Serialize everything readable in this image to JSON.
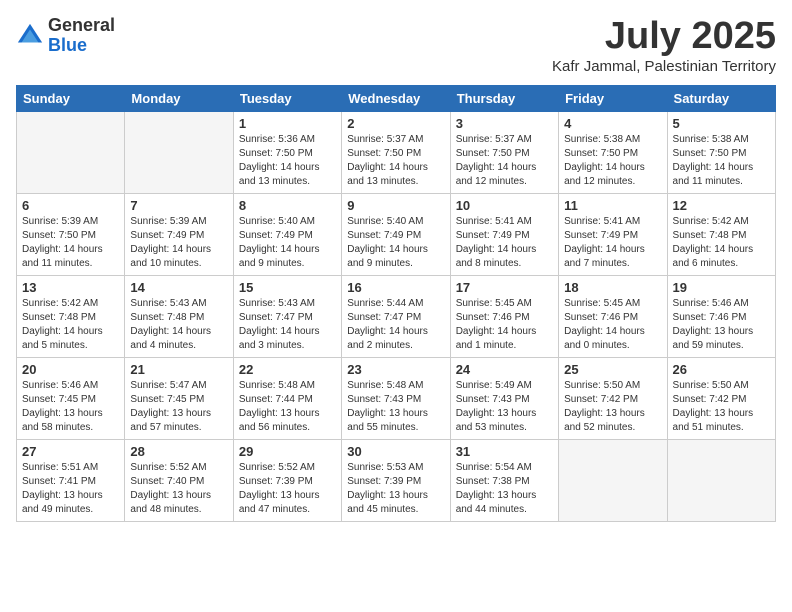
{
  "header": {
    "logo_general": "General",
    "logo_blue": "Blue",
    "month_year": "July 2025",
    "location": "Kafr Jammal, Palestinian Territory"
  },
  "days_of_week": [
    "Sunday",
    "Monday",
    "Tuesday",
    "Wednesday",
    "Thursday",
    "Friday",
    "Saturday"
  ],
  "weeks": [
    [
      {
        "day": "",
        "sunrise": "",
        "sunset": "",
        "daylight": "",
        "empty": true
      },
      {
        "day": "",
        "sunrise": "",
        "sunset": "",
        "daylight": "",
        "empty": true
      },
      {
        "day": "1",
        "sunrise": "Sunrise: 5:36 AM",
        "sunset": "Sunset: 7:50 PM",
        "daylight": "Daylight: 14 hours and 13 minutes."
      },
      {
        "day": "2",
        "sunrise": "Sunrise: 5:37 AM",
        "sunset": "Sunset: 7:50 PM",
        "daylight": "Daylight: 14 hours and 13 minutes."
      },
      {
        "day": "3",
        "sunrise": "Sunrise: 5:37 AM",
        "sunset": "Sunset: 7:50 PM",
        "daylight": "Daylight: 14 hours and 12 minutes."
      },
      {
        "day": "4",
        "sunrise": "Sunrise: 5:38 AM",
        "sunset": "Sunset: 7:50 PM",
        "daylight": "Daylight: 14 hours and 12 minutes."
      },
      {
        "day": "5",
        "sunrise": "Sunrise: 5:38 AM",
        "sunset": "Sunset: 7:50 PM",
        "daylight": "Daylight: 14 hours and 11 minutes."
      }
    ],
    [
      {
        "day": "6",
        "sunrise": "Sunrise: 5:39 AM",
        "sunset": "Sunset: 7:50 PM",
        "daylight": "Daylight: 14 hours and 11 minutes."
      },
      {
        "day": "7",
        "sunrise": "Sunrise: 5:39 AM",
        "sunset": "Sunset: 7:49 PM",
        "daylight": "Daylight: 14 hours and 10 minutes."
      },
      {
        "day": "8",
        "sunrise": "Sunrise: 5:40 AM",
        "sunset": "Sunset: 7:49 PM",
        "daylight": "Daylight: 14 hours and 9 minutes."
      },
      {
        "day": "9",
        "sunrise": "Sunrise: 5:40 AM",
        "sunset": "Sunset: 7:49 PM",
        "daylight": "Daylight: 14 hours and 9 minutes."
      },
      {
        "day": "10",
        "sunrise": "Sunrise: 5:41 AM",
        "sunset": "Sunset: 7:49 PM",
        "daylight": "Daylight: 14 hours and 8 minutes."
      },
      {
        "day": "11",
        "sunrise": "Sunrise: 5:41 AM",
        "sunset": "Sunset: 7:49 PM",
        "daylight": "Daylight: 14 hours and 7 minutes."
      },
      {
        "day": "12",
        "sunrise": "Sunrise: 5:42 AM",
        "sunset": "Sunset: 7:48 PM",
        "daylight": "Daylight: 14 hours and 6 minutes."
      }
    ],
    [
      {
        "day": "13",
        "sunrise": "Sunrise: 5:42 AM",
        "sunset": "Sunset: 7:48 PM",
        "daylight": "Daylight: 14 hours and 5 minutes."
      },
      {
        "day": "14",
        "sunrise": "Sunrise: 5:43 AM",
        "sunset": "Sunset: 7:48 PM",
        "daylight": "Daylight: 14 hours and 4 minutes."
      },
      {
        "day": "15",
        "sunrise": "Sunrise: 5:43 AM",
        "sunset": "Sunset: 7:47 PM",
        "daylight": "Daylight: 14 hours and 3 minutes."
      },
      {
        "day": "16",
        "sunrise": "Sunrise: 5:44 AM",
        "sunset": "Sunset: 7:47 PM",
        "daylight": "Daylight: 14 hours and 2 minutes."
      },
      {
        "day": "17",
        "sunrise": "Sunrise: 5:45 AM",
        "sunset": "Sunset: 7:46 PM",
        "daylight": "Daylight: 14 hours and 1 minute."
      },
      {
        "day": "18",
        "sunrise": "Sunrise: 5:45 AM",
        "sunset": "Sunset: 7:46 PM",
        "daylight": "Daylight: 14 hours and 0 minutes."
      },
      {
        "day": "19",
        "sunrise": "Sunrise: 5:46 AM",
        "sunset": "Sunset: 7:46 PM",
        "daylight": "Daylight: 13 hours and 59 minutes."
      }
    ],
    [
      {
        "day": "20",
        "sunrise": "Sunrise: 5:46 AM",
        "sunset": "Sunset: 7:45 PM",
        "daylight": "Daylight: 13 hours and 58 minutes."
      },
      {
        "day": "21",
        "sunrise": "Sunrise: 5:47 AM",
        "sunset": "Sunset: 7:45 PM",
        "daylight": "Daylight: 13 hours and 57 minutes."
      },
      {
        "day": "22",
        "sunrise": "Sunrise: 5:48 AM",
        "sunset": "Sunset: 7:44 PM",
        "daylight": "Daylight: 13 hours and 56 minutes."
      },
      {
        "day": "23",
        "sunrise": "Sunrise: 5:48 AM",
        "sunset": "Sunset: 7:43 PM",
        "daylight": "Daylight: 13 hours and 55 minutes."
      },
      {
        "day": "24",
        "sunrise": "Sunrise: 5:49 AM",
        "sunset": "Sunset: 7:43 PM",
        "daylight": "Daylight: 13 hours and 53 minutes."
      },
      {
        "day": "25",
        "sunrise": "Sunrise: 5:50 AM",
        "sunset": "Sunset: 7:42 PM",
        "daylight": "Daylight: 13 hours and 52 minutes."
      },
      {
        "day": "26",
        "sunrise": "Sunrise: 5:50 AM",
        "sunset": "Sunset: 7:42 PM",
        "daylight": "Daylight: 13 hours and 51 minutes."
      }
    ],
    [
      {
        "day": "27",
        "sunrise": "Sunrise: 5:51 AM",
        "sunset": "Sunset: 7:41 PM",
        "daylight": "Daylight: 13 hours and 49 minutes."
      },
      {
        "day": "28",
        "sunrise": "Sunrise: 5:52 AM",
        "sunset": "Sunset: 7:40 PM",
        "daylight": "Daylight: 13 hours and 48 minutes."
      },
      {
        "day": "29",
        "sunrise": "Sunrise: 5:52 AM",
        "sunset": "Sunset: 7:39 PM",
        "daylight": "Daylight: 13 hours and 47 minutes."
      },
      {
        "day": "30",
        "sunrise": "Sunrise: 5:53 AM",
        "sunset": "Sunset: 7:39 PM",
        "daylight": "Daylight: 13 hours and 45 minutes."
      },
      {
        "day": "31",
        "sunrise": "Sunrise: 5:54 AM",
        "sunset": "Sunset: 7:38 PM",
        "daylight": "Daylight: 13 hours and 44 minutes."
      },
      {
        "day": "",
        "sunrise": "",
        "sunset": "",
        "daylight": "",
        "empty": true
      },
      {
        "day": "",
        "sunrise": "",
        "sunset": "",
        "daylight": "",
        "empty": true
      }
    ]
  ]
}
